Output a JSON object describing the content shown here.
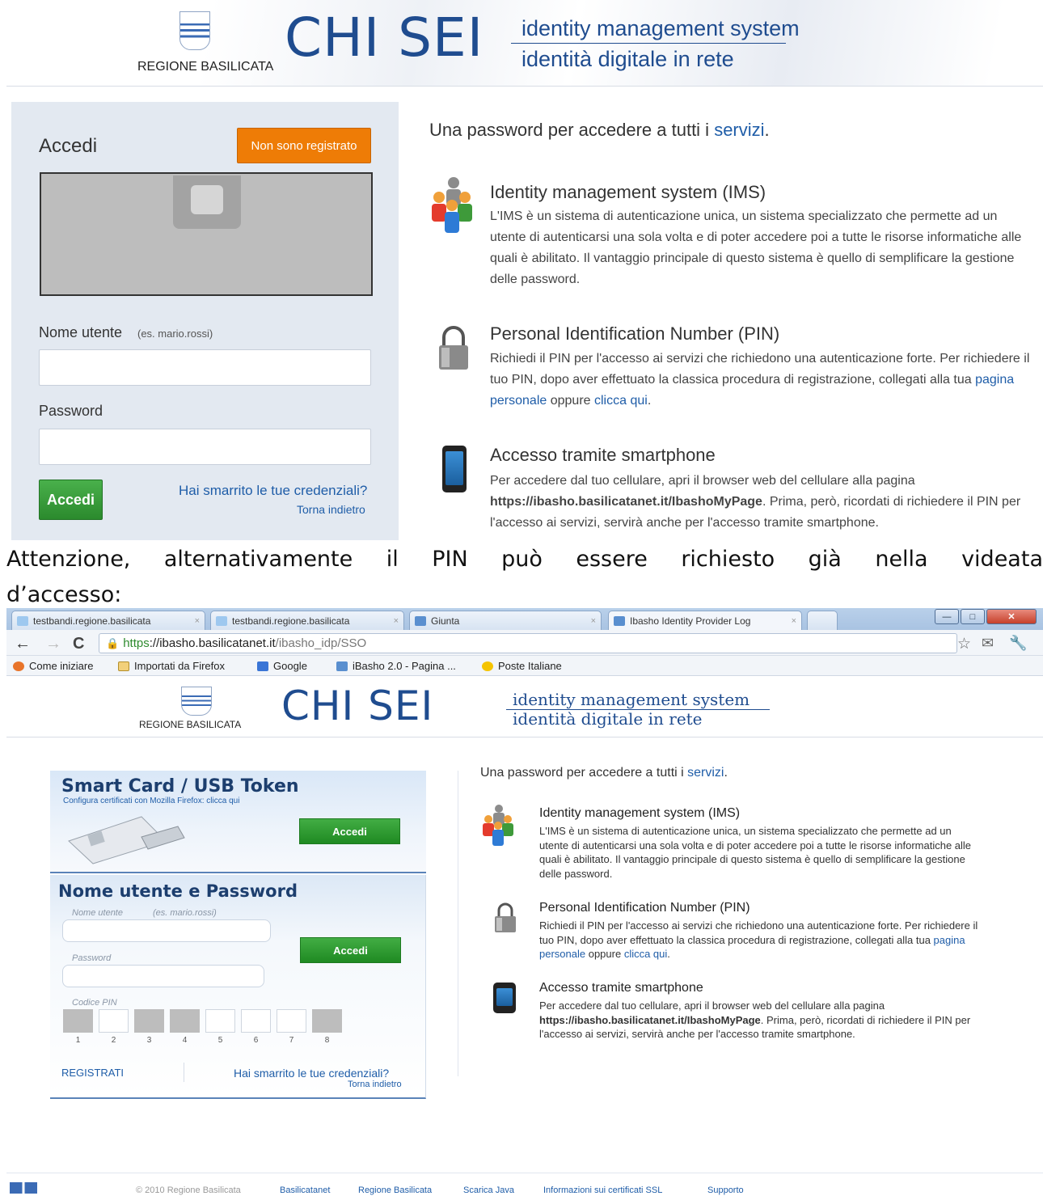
{
  "section1": {
    "header": {
      "logo_label": "REGIONE BASILICATA",
      "brand": "CHI SEI",
      "ims_line1": "identity management system",
      "ims_line2": "identità digitale in rete"
    },
    "login": {
      "title": "Accedi",
      "register_button": "Non sono registrato",
      "username_label": "Nome utente",
      "username_hint": "(es. mario.rossi)",
      "username_value": "",
      "password_label": "Password",
      "password_value": "",
      "submit_button": "Accedi",
      "forgot_link": "Hai smarrito le tue credenziali?",
      "back_link": "Torna indietro"
    },
    "info": {
      "intro_text": "Una password per accedere a tutti i ",
      "intro_link": "servizi",
      "intro_end": ".",
      "ims_title": "Identity management system (IMS)",
      "ims_body": "L'IMS è un sistema di autenticazione unica, un sistema specializzato che permette ad un utente di autenticarsi una sola volta e di poter accedere poi a tutte le risorse informatiche alle quali è abilitato. Il vantaggio principale di questo sistema è quello di semplificare la gestione delle password.",
      "pin_title": "Personal Identification Number (PIN)",
      "pin_body": "Richiedi il PIN per l'accesso ai servizi che richiedono una autenticazione forte. Per richiedere il tuo PIN, dopo aver effettuato la classica procedura di registrazione, collegati alla tua ",
      "pin_link1": "pagina personale",
      "pin_mid": " oppure ",
      "pin_link2": "clicca qui",
      "pin_end": ".",
      "phone_title": "Accesso tramite smartphone",
      "phone_body1": "Per accedere dal tuo cellulare, apri il browser web del cellulare alla pagina ",
      "phone_url": "https://ibasho.basilicatanet.it/IbashoMyPage",
      "phone_body2": ". Prima, però, ricordati di richiedere il PIN per l'accesso ai servizi, servirà anche per l'accesso tramite smartphone."
    }
  },
  "attention": {
    "line1": "Attenzione, alternativamente il PIN può essere richiesto già nella videata",
    "line2": "d’accesso:"
  },
  "browser": {
    "tabs": [
      {
        "label": "testbandi.regione.basilicata"
      },
      {
        "label": "testbandi.regione.basilicata"
      },
      {
        "label": "Giunta"
      },
      {
        "label": "Ibasho Identity Provider Log"
      }
    ],
    "url_scheme": "https",
    "url_host": "://ibasho.basilicatanet.it",
    "url_path": "/ibasho_idp/SSO",
    "bookmarks": [
      "Come iniziare",
      "Importati da Firefox",
      "Google",
      "iBasho 2.0 - Pagina ...",
      "Poste Italiane"
    ],
    "colors": {
      "accent": "#1f4c8f",
      "green": "#2b8a2d",
      "orange": "#ee7c06"
    }
  },
  "section2": {
    "header": {
      "logo_label": "REGIONE BASILICATA",
      "brand": "CHI SEI",
      "ims_line1": "identity management system",
      "ims_line2": "identità digitale in rete"
    },
    "smartcard": {
      "title": "Smart Card / USB Token",
      "config_link": "Configura certificati con Mozilla Firefox: clicca qui",
      "button": "Accedi"
    },
    "userpass": {
      "title": "Nome utente e Password",
      "username_label": "Nome utente",
      "username_hint": "(es. mario.rossi)",
      "password_label": "Password",
      "pin_label": "Codice PIN",
      "pin_positions": [
        "1",
        "2",
        "3",
        "4",
        "5",
        "6",
        "7",
        "8"
      ],
      "button": "Accedi",
      "register_link": "REGISTRATI",
      "forgot_link": "Hai smarrito le tue credenziali?",
      "back_link": "Torna indietro"
    },
    "info": {
      "intro_text": "Una password per accedere a tutti i ",
      "intro_link": "servizi",
      "intro_end": ".",
      "ims_title": "Identity management system (IMS)",
      "ims_body": "L'IMS è un sistema di autenticazione unica, un sistema specializzato che permette ad un utente di autenticarsi una sola volta e di poter accedere poi a tutte le risorse informatiche alle quali è abilitato. Il vantaggio principale di questo sistema è quello di semplificare la gestione delle password.",
      "pin_title": "Personal Identification Number (PIN)",
      "pin_body": "Richiedi il PIN per l'accesso ai servizi che richiedono una autenticazione forte. Per richiedere il tuo PIN, dopo aver effettuato la classica procedura di registrazione, collegati alla tua ",
      "pin_link1": "pagina personale",
      "pin_mid": " oppure ",
      "pin_link2": "clicca qui",
      "pin_end": ".",
      "phone_title": "Accesso tramite smartphone",
      "phone_body1": "Per accedere dal tuo cellulare, apri il browser web del cellulare alla pagina ",
      "phone_url": "https://ibasho.basilicatanet.it/IbashoMyPage",
      "phone_body2": ". Prima, però, ricordati di richiedere il PIN per l'accesso ai servizi, servirà anche per l'accesso tramite smartphone."
    },
    "footer": {
      "copyright": "© 2010 Regione Basilicata",
      "links": [
        "Basilicatanet",
        "Regione Basilicata",
        "Scarica Java",
        "Informazioni sui certificati SSL",
        "Supporto"
      ]
    }
  }
}
